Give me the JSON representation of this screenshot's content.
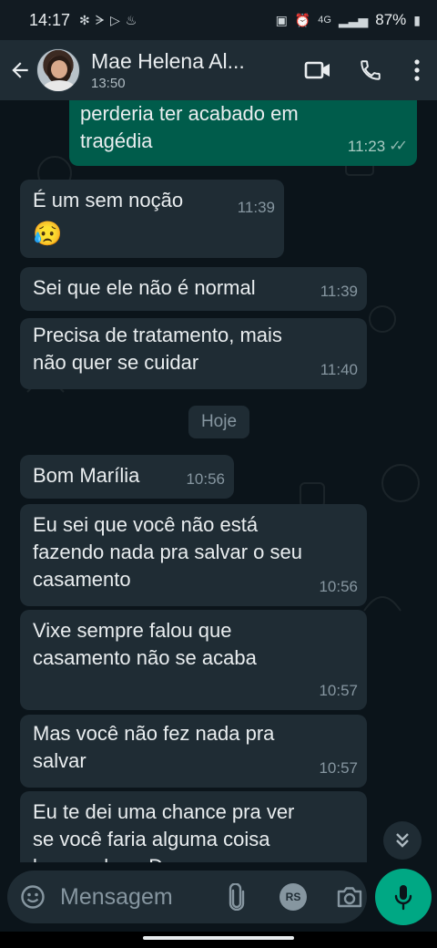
{
  "status_bar": {
    "time": "14:17",
    "left_icons": [
      "fan-icon",
      "app-icon",
      "play-store-icon",
      "notification-icon"
    ],
    "network": "4G",
    "battery": "87%"
  },
  "header": {
    "contact_name": "Mae Helena Al...",
    "subtitle": "13:50"
  },
  "messages": [
    {
      "direction": "out",
      "lines": [
        "perderia ter acabado em",
        "tragédia"
      ],
      "time": "11:23",
      "read": true
    },
    {
      "direction": "in",
      "lines": [
        "É um sem noção"
      ],
      "emoji": "😥",
      "time": "11:39"
    },
    {
      "direction": "in",
      "lines": [
        "Sei que ele não é normal"
      ],
      "time": "11:39"
    },
    {
      "direction": "in",
      "lines": [
        "Precisa de tratamento, mais",
        "não quer se cuidar"
      ],
      "time": "11:40"
    },
    {
      "direction": "in",
      "lines": [
        "Bom Marília"
      ],
      "time": "10:56"
    },
    {
      "direction": "in",
      "lines": [
        "Eu sei que você não está",
        "fazendo nada pra salvar o seu",
        "casamento"
      ],
      "time": "10:56"
    },
    {
      "direction": "in",
      "lines": [
        "Vixe sempre falou que",
        "casamento não se acaba"
      ],
      "time": "10:57"
    },
    {
      "direction": "in",
      "lines": [
        "Mas você não fez nada pra",
        "salvar"
      ],
      "time": "10:57"
    },
    {
      "direction": "in",
      "lines": [
        "Eu te dei uma chance pra ver",
        "se você faria alguma coisa",
        "bem, sabe a Deus"
      ],
      "time": ""
    }
  ],
  "date_chip": "Hoje",
  "composer": {
    "placeholder": "Mensagem",
    "rs_label": "RS"
  },
  "colors": {
    "header_bg": "#1f2c34",
    "chat_bg": "#0b141a",
    "incoming_bubble": "#1f2c34",
    "outgoing_bubble": "#005c4b",
    "accent": "#00a884"
  }
}
